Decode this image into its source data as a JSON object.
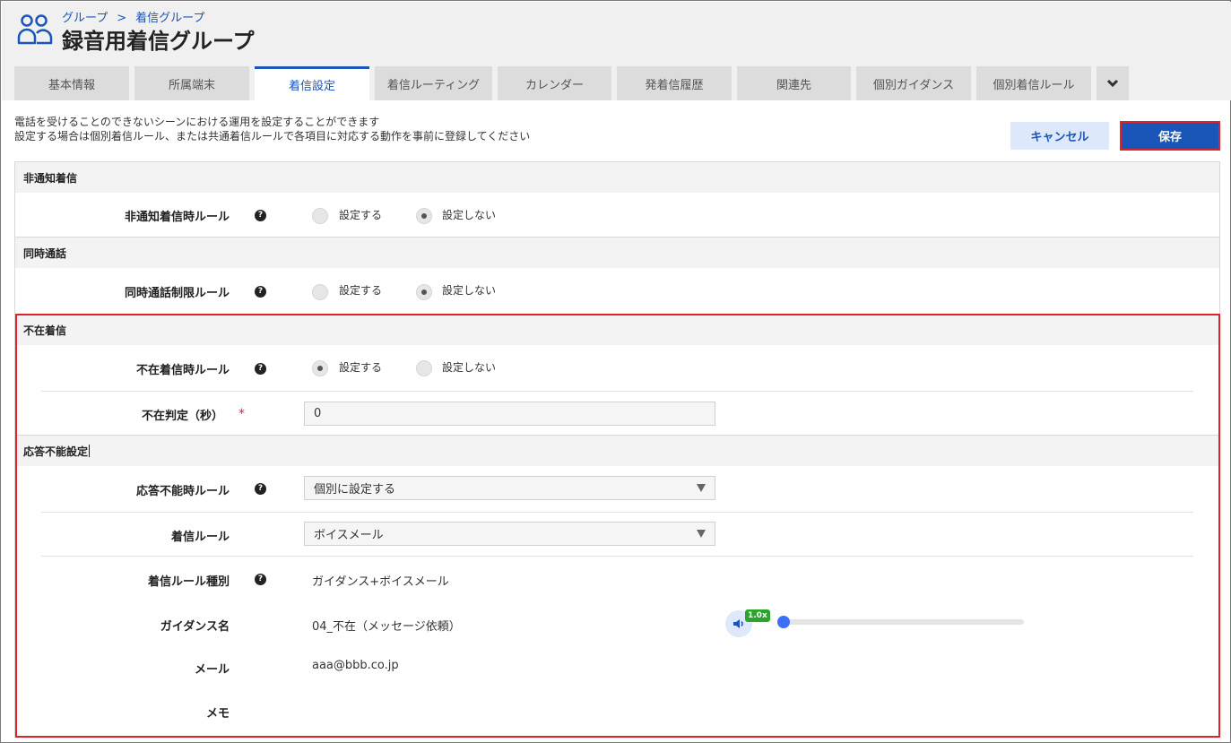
{
  "breadcrumb": {
    "item1": "グループ",
    "separator": ">",
    "item2": "着信グループ"
  },
  "page_title": "録音用着信グループ",
  "tabs": [
    {
      "label": "基本情報"
    },
    {
      "label": "所属端末"
    },
    {
      "label": "着信設定",
      "active": true
    },
    {
      "label": "着信ルーティング"
    },
    {
      "label": "カレンダー"
    },
    {
      "label": "発着信履歴"
    },
    {
      "label": "関連先"
    },
    {
      "label": "個別ガイダンス"
    },
    {
      "label": "個別着信ルール"
    }
  ],
  "tab_more_icon": "chevron-down-icon",
  "description": {
    "line1": "電話を受けることのできないシーンにおける運用を設定することができます",
    "line2": "設定する場合は個別着信ルール、または共通着信ルールで各項目に対応する動作を事前に登録してください"
  },
  "actions": {
    "cancel": "キャンセル",
    "save": "保存"
  },
  "sections": {
    "anonymous": {
      "title": "非通知着信",
      "rule_label": "非通知着信時ルール",
      "option_on": "設定する",
      "option_off": "設定しない",
      "selected": "設定しない"
    },
    "concurrent": {
      "title": "同時通話",
      "rule_label": "同時通話制限ルール",
      "option_on": "設定する",
      "option_off": "設定しない",
      "selected": "設定しない"
    },
    "absent": {
      "title": "不在着信",
      "rule_label": "不在着信時ルール",
      "option_on": "設定する",
      "option_off": "設定しない",
      "selected": "設定する",
      "timeout_label": "不在判定（秒）",
      "required_mark": "*",
      "timeout_value": "0"
    },
    "unanswerable": {
      "title": "応答不能設定",
      "rule_label": "応答不能時ルール",
      "rule_value": "個別に設定する",
      "incoming_rule_label": "着信ルール",
      "incoming_rule_value": "ボイスメール",
      "rule_type_label": "着信ルール種別",
      "rule_type_value": "ガイダンス+ボイスメール",
      "guidance_label": "ガイダンス名",
      "guidance_value": "04_不在（メッセージ依頼）",
      "playback_speed": "1.0x",
      "playback_progress_percent": 0,
      "mail_label": "メール",
      "mail_value": "aaa@bbb.co.jp",
      "memo_label": "メモ",
      "memo_value": ""
    }
  },
  "help_glyph": "?",
  "colors": {
    "accent": "#1a56b8",
    "highlight": "#e0222a",
    "speed_badge": "#2aa52a"
  }
}
